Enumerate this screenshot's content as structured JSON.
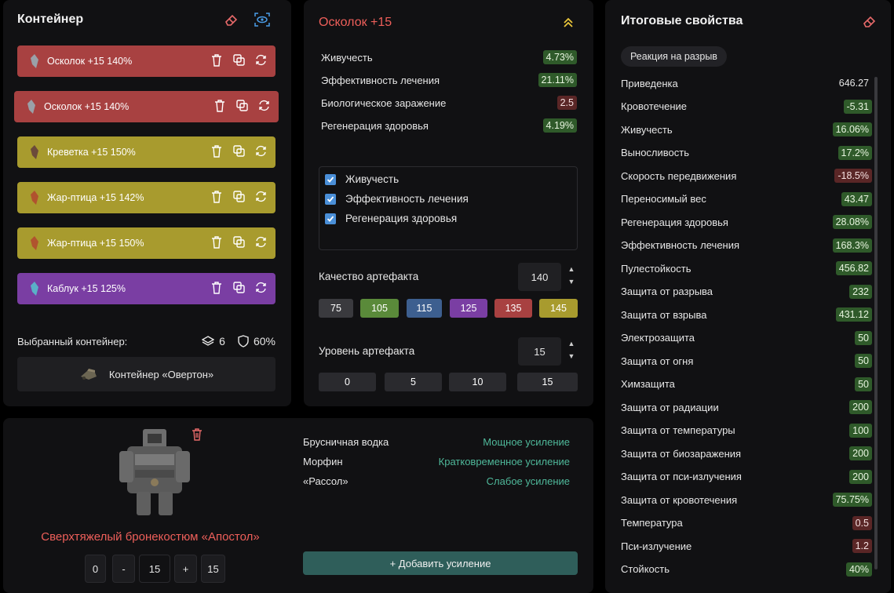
{
  "left": {
    "title": "Контейнер",
    "artifacts": [
      {
        "label": "Осколок +15 140%",
        "color": "#a84141"
      },
      {
        "label": "Осколок +15 140%",
        "color": "#a84141"
      },
      {
        "label": "Креветка +15 150%",
        "color": "#a89b2e"
      },
      {
        "label": "Жар-птица +15 142%",
        "color": "#a89b2e"
      },
      {
        "label": "Жар-птица +15 150%",
        "color": "#a89b2e"
      },
      {
        "label": "Каблук +15 125%",
        "color": "#7a3ea3"
      }
    ],
    "selected_label": "Выбранный контейнер:",
    "slots": "6",
    "protection": "60%",
    "container_name": "Контейнер «Овертон»"
  },
  "middle": {
    "title": "Осколок +15",
    "stats": [
      {
        "name": "Живучесть",
        "value": "4.73%",
        "tone": "g"
      },
      {
        "name": "Эффективность лечения",
        "value": "21.11%",
        "tone": "g"
      },
      {
        "name": "Биологическое заражение",
        "value": "2.5",
        "tone": "r"
      },
      {
        "name": "Регенерация здоровья",
        "value": "4.19%",
        "tone": "g"
      }
    ],
    "checks": [
      "Живучесть",
      "Эффективность лечения",
      "Регенерация здоровья"
    ],
    "quality_label": "Качество артефакта",
    "quality_value": "140",
    "quality_presets": [
      {
        "label": "75",
        "color": "#3a3a3e"
      },
      {
        "label": "105",
        "color": "#5a8a3a"
      },
      {
        "label": "115",
        "color": "#3d5f8f"
      },
      {
        "label": "125",
        "color": "#7a3ea3"
      },
      {
        "label": "135",
        "color": "#a84141"
      },
      {
        "label": "145",
        "color": "#a89b2e"
      }
    ],
    "level_label": "Уровень артефакта",
    "level_value": "15",
    "level_presets": [
      "0",
      "5",
      "10",
      "15"
    ]
  },
  "right": {
    "title": "Итоговые свойства",
    "reaction": "Реакция на разрыв",
    "rows": [
      {
        "name": "Приведенка",
        "value": "646.27",
        "tone": "plain"
      },
      {
        "name": "Кровотечение",
        "value": "-5.31",
        "tone": "g"
      },
      {
        "name": "Живучесть",
        "value": "16.06%",
        "tone": "g"
      },
      {
        "name": "Выносливость",
        "value": "17.2%",
        "tone": "g"
      },
      {
        "name": "Скорость передвижения",
        "value": "-18.5%",
        "tone": "r"
      },
      {
        "name": "Переносимый вес",
        "value": "43.47",
        "tone": "g"
      },
      {
        "name": "Регенерация здоровья",
        "value": "28.08%",
        "tone": "g"
      },
      {
        "name": "Эффективность лечения",
        "value": "168.3%",
        "tone": "g"
      },
      {
        "name": "Пулестойкость",
        "value": "456.82",
        "tone": "g"
      },
      {
        "name": "Защита от разрыва",
        "value": "232",
        "tone": "g"
      },
      {
        "name": "Защита от взрыва",
        "value": "431.12",
        "tone": "g"
      },
      {
        "name": "Электрозащита",
        "value": "50",
        "tone": "g"
      },
      {
        "name": "Защита от огня",
        "value": "50",
        "tone": "g"
      },
      {
        "name": "Химзащита",
        "value": "50",
        "tone": "g"
      },
      {
        "name": "Защита от радиации",
        "value": "200",
        "tone": "g"
      },
      {
        "name": "Защита от температуры",
        "value": "100",
        "tone": "g"
      },
      {
        "name": "Защита от биозаражения",
        "value": "200",
        "tone": "g"
      },
      {
        "name": "Защита от пси-излучения",
        "value": "200",
        "tone": "g"
      },
      {
        "name": "Защита от кровотечения",
        "value": "75.75%",
        "tone": "g"
      },
      {
        "name": "Температура",
        "value": "0.5",
        "tone": "r"
      },
      {
        "name": "Пси-излучение",
        "value": "1.2",
        "tone": "r"
      },
      {
        "name": "Стойкость",
        "value": "40%",
        "tone": "g"
      }
    ]
  },
  "bottom": {
    "suit_name": "Сверхтяжелый бронекостюм «Апостол»",
    "controls": [
      "0",
      "-",
      "15",
      "+",
      "15"
    ],
    "boosts": [
      {
        "name": "Брусничная водка",
        "effect": "Мощное усиление"
      },
      {
        "name": "Морфин",
        "effect": "Кратковременное усиление"
      },
      {
        "name": "«Рассол»",
        "effect": "Слабое усиление"
      }
    ],
    "add_button": "+ Добавить усиление"
  }
}
